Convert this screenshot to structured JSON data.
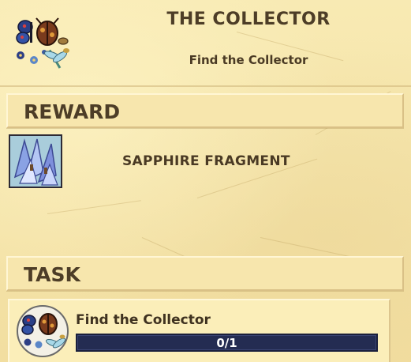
{
  "quest": {
    "title": "THE COLLECTOR",
    "subtitle": "Find the Collector"
  },
  "reward": {
    "section_label": "REWARD",
    "item_name": "SAPPHIRE FRAGMENT",
    "item_icon": "sapphire-fragment-icon"
  },
  "task": {
    "section_label": "TASK",
    "name": "Find the Collector",
    "icon": "collector-icon",
    "progress_text": "0/1",
    "progress_fraction": 0
  },
  "colors": {
    "parchment": "#f6e6a9",
    "text": "#4a3a24",
    "progress_bar": "#242c52",
    "progress_fill": "#4a7ac8"
  }
}
